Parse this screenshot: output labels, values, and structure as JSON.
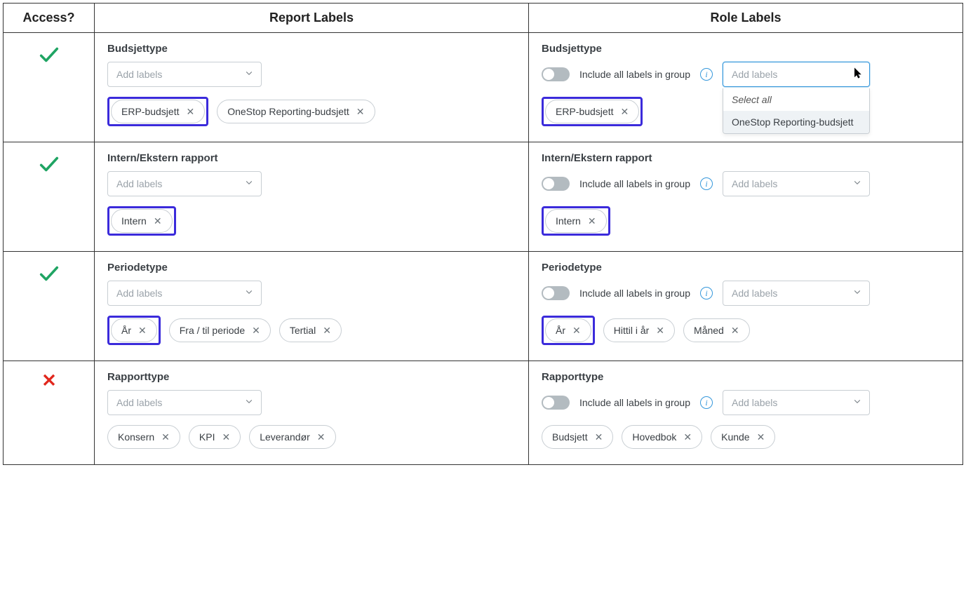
{
  "headers": {
    "access": "Access?",
    "report": "Report Labels",
    "role": "Role Labels"
  },
  "common": {
    "addLabelsPlaceholder": "Add labels",
    "includeAllLabel": "Include all labels in group",
    "dropdown": {
      "selectAll": "Select all",
      "option1": "OneStop Reporting-budsjett"
    }
  },
  "rows": [
    {
      "access": "check",
      "report": {
        "title": "Budsjettype",
        "chips": [
          {
            "text": "ERP-budsjett",
            "highlight": true
          },
          {
            "text": "OneStop Reporting-budsjett",
            "highlight": false
          }
        ]
      },
      "role": {
        "title": "Budsjettype",
        "dropdownOpen": true,
        "chips": [
          {
            "text": "ERP-budsjett",
            "highlight": true
          }
        ]
      }
    },
    {
      "access": "check",
      "report": {
        "title": "Intern/Ekstern rapport",
        "chips": [
          {
            "text": "Intern",
            "highlight": true
          }
        ]
      },
      "role": {
        "title": "Intern/Ekstern rapport",
        "dropdownOpen": false,
        "chips": [
          {
            "text": "Intern",
            "highlight": true
          }
        ]
      }
    },
    {
      "access": "check",
      "report": {
        "title": "Periodetype",
        "chips": [
          {
            "text": "År",
            "highlight": true
          },
          {
            "text": "Fra / til periode",
            "highlight": false
          },
          {
            "text": "Tertial",
            "highlight": false
          }
        ]
      },
      "role": {
        "title": "Periodetype",
        "dropdownOpen": false,
        "chips": [
          {
            "text": "År",
            "highlight": true
          },
          {
            "text": "Hittil i år",
            "highlight": false
          },
          {
            "text": "Måned",
            "highlight": false
          }
        ]
      }
    },
    {
      "access": "cross",
      "report": {
        "title": "Rapporttype",
        "chips": [
          {
            "text": "Konsern",
            "highlight": false
          },
          {
            "text": "KPI",
            "highlight": false
          },
          {
            "text": "Leverandør",
            "highlight": false
          }
        ]
      },
      "role": {
        "title": "Rapporttype",
        "dropdownOpen": false,
        "chips": [
          {
            "text": "Budsjett",
            "highlight": false
          },
          {
            "text": "Hovedbok",
            "highlight": false
          },
          {
            "text": "Kunde",
            "highlight": false
          }
        ]
      }
    }
  ]
}
